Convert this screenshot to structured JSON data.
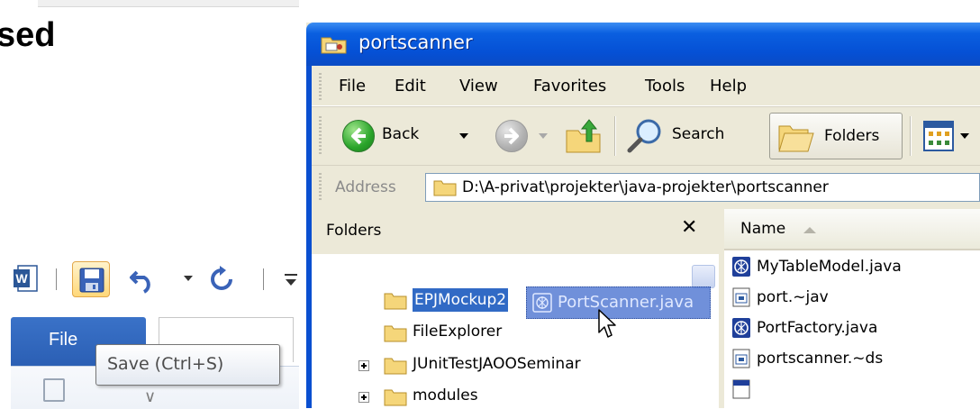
{
  "slide": {
    "partial_word": "sed"
  },
  "word": {
    "file_tab_label": "File",
    "tooltip": "Save (Ctrl+S)",
    "qat_icons": [
      "word-logo-icon",
      "save-icon",
      "undo-icon",
      "redo-icon",
      "customize-icon"
    ]
  },
  "explorer": {
    "title": "portscanner",
    "menu": [
      "File",
      "Edit",
      "View",
      "Favorites",
      "Tools",
      "Help"
    ],
    "toolbar": {
      "back_label": "Back",
      "search_label": "Search",
      "folders_label": "Folders"
    },
    "address": {
      "label": "Address",
      "value": "D:\\A-privat\\projekter\\java-projekter\\portscanner"
    },
    "folders_pane": {
      "title": "Folders",
      "close_glyph": "✕",
      "items": [
        {
          "label": "EPJMockup2",
          "selected": true,
          "expandable": false
        },
        {
          "label": "FileExplorer",
          "selected": false,
          "expandable": false
        },
        {
          "label": "JUnitTestJAOOSeminar",
          "selected": false,
          "expandable": true
        },
        {
          "label": "modules",
          "selected": false,
          "expandable": true
        }
      ]
    },
    "files_pane": {
      "column_name": "Name",
      "files": [
        {
          "name": "MyTableModel.java",
          "icon": "java-file-icon"
        },
        {
          "name": "port.~jav",
          "icon": "backup-file-icon"
        },
        {
          "name": "PortFactory.java",
          "icon": "java-file-icon"
        },
        {
          "name": "portscanner.~ds",
          "icon": "backup-file-icon"
        }
      ]
    },
    "drag": {
      "label": "PortScanner.java",
      "icon": "java-file-icon"
    }
  },
  "colors": {
    "xp_title": "#0550d5",
    "selection": "#316ac5",
    "chrome": "#ece9d8",
    "ribbon_file": "#2b5fb4"
  }
}
